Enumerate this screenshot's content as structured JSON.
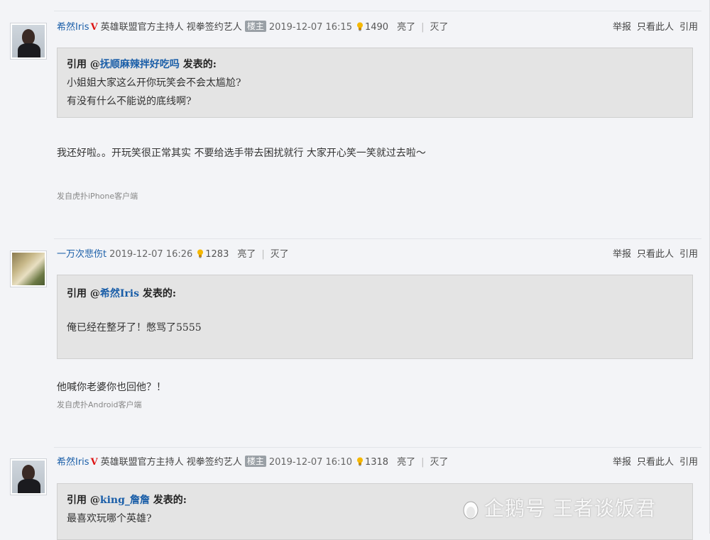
{
  "posts": [
    {
      "user": "希然Iris",
      "verified": "V",
      "title": "英雄联盟官方主持人 视拳签约艺人",
      "op_badge": "楼主",
      "time": "2019-12-07 16:15",
      "lights": "1490",
      "light_label": "亮了",
      "pipe": "|",
      "dark_label": "灭了",
      "ops": {
        "report": "举报",
        "only": "只看此人",
        "quote": "引用"
      },
      "quote": {
        "prefix": "引用 @",
        "user": "抚顺麻辣拌好吃吗",
        "suffix": " 发表的:",
        "lines": [
          "小姐姐大家这么开你玩笑会不会太尴尬?",
          "有没有什么不能说的底线啊?"
        ]
      },
      "body": "我还好啦。。开玩笑很正常其实 不要给选手带去困扰就行 大家开心笑一笑就过去啦～",
      "source": "发自虎扑iPhone客户端"
    },
    {
      "user": "一万次悲伤t",
      "time": "2019-12-07 16:26",
      "lights": "1283",
      "light_label": "亮了",
      "pipe": "|",
      "dark_label": "灭了",
      "ops": {
        "report": "举报",
        "only": "只看此人",
        "quote": "引用"
      },
      "quote": {
        "prefix": "引用 @",
        "user": "希然Iris",
        "suffix": " 发表的:",
        "lines": [
          "俺已经在整牙了！憋骂了5555"
        ]
      },
      "body": "他喊你老婆你也回他？！",
      "source": "发自虎扑Android客户端"
    },
    {
      "user": "希然Iris",
      "verified": "V",
      "title": "英雄联盟官方主持人 视拳签约艺人",
      "op_badge": "楼主",
      "time": "2019-12-07 16:10",
      "lights": "1318",
      "light_label": "亮了",
      "pipe": "|",
      "dark_label": "灭了",
      "ops": {
        "report": "举报",
        "only": "只看此人",
        "quote": "引用"
      },
      "quote": {
        "prefix": "引用 @",
        "user": "king_詹詹",
        "suffix": " 发表的:",
        "lines": [
          "最喜欢玩哪个英雄?"
        ]
      }
    }
  ],
  "watermark": "企鹅号 王者谈饭君",
  "icons": {
    "bulb": "lightbulb-icon",
    "watermark": "penguin-icon"
  },
  "colors": {
    "link": "#1a5ea8",
    "verified": "#dd1111",
    "quote_bg": "#e4e4e4",
    "page_bg": "#f3f4f7"
  }
}
